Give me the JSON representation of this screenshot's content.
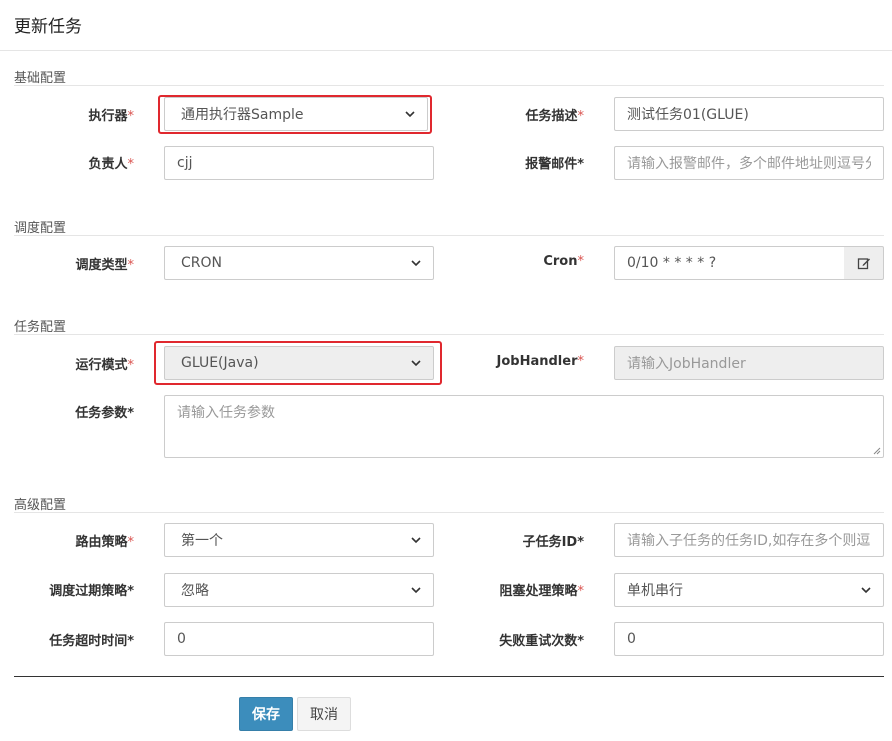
{
  "modal": {
    "title": "更新任务"
  },
  "sections": {
    "basic": "基础配置",
    "schedule": "调度配置",
    "task": "任务配置",
    "advanced": "高级配置"
  },
  "fields": {
    "executor": {
      "label": "执行器",
      "value": "通用执行器Sample",
      "required": true
    },
    "job_desc": {
      "label": "任务描述",
      "value": "测试任务01(GLUE)",
      "required": true
    },
    "author": {
      "label": "负责人",
      "value": "cjj",
      "required": true
    },
    "alarm_email": {
      "label": "报警邮件*",
      "placeholder": "请输入报警邮件，多个邮件地址则逗号分"
    },
    "schedule_type": {
      "label": "调度类型",
      "value": "CRON",
      "required": true
    },
    "cron": {
      "label": "Cron",
      "value": "0/10 * * * * ?",
      "required": true
    },
    "glue_type": {
      "label": "运行模式",
      "value": "GLUE(Java)",
      "required": true
    },
    "job_handler": {
      "label": "JobHandler",
      "placeholder": "请输入JobHandler",
      "required": true
    },
    "job_param": {
      "label": "任务参数*",
      "placeholder": "请输入任务参数"
    },
    "route_strategy": {
      "label": "路由策略",
      "value": "第一个",
      "required": true
    },
    "child_job_id": {
      "label": "子任务ID*",
      "placeholder": "请输入子任务的任务ID,如存在多个则逗"
    },
    "misfire_strategy": {
      "label": "调度过期策略*",
      "value": "忽略"
    },
    "block_strategy": {
      "label": "阻塞处理策略",
      "value": "单机串行",
      "required": true
    },
    "timeout": {
      "label": "任务超时时间*",
      "value": "0"
    },
    "fail_retry": {
      "label": "失败重试次数*",
      "value": "0"
    }
  },
  "buttons": {
    "save": "保存",
    "cancel": "取消"
  },
  "colors": {
    "required_star": "#d9534f",
    "highlight": "#e0282e",
    "primary": "#3c8dbc"
  },
  "icons": {
    "cron_edit": "edit-icon",
    "select_arrow": "chevron-down-icon"
  }
}
